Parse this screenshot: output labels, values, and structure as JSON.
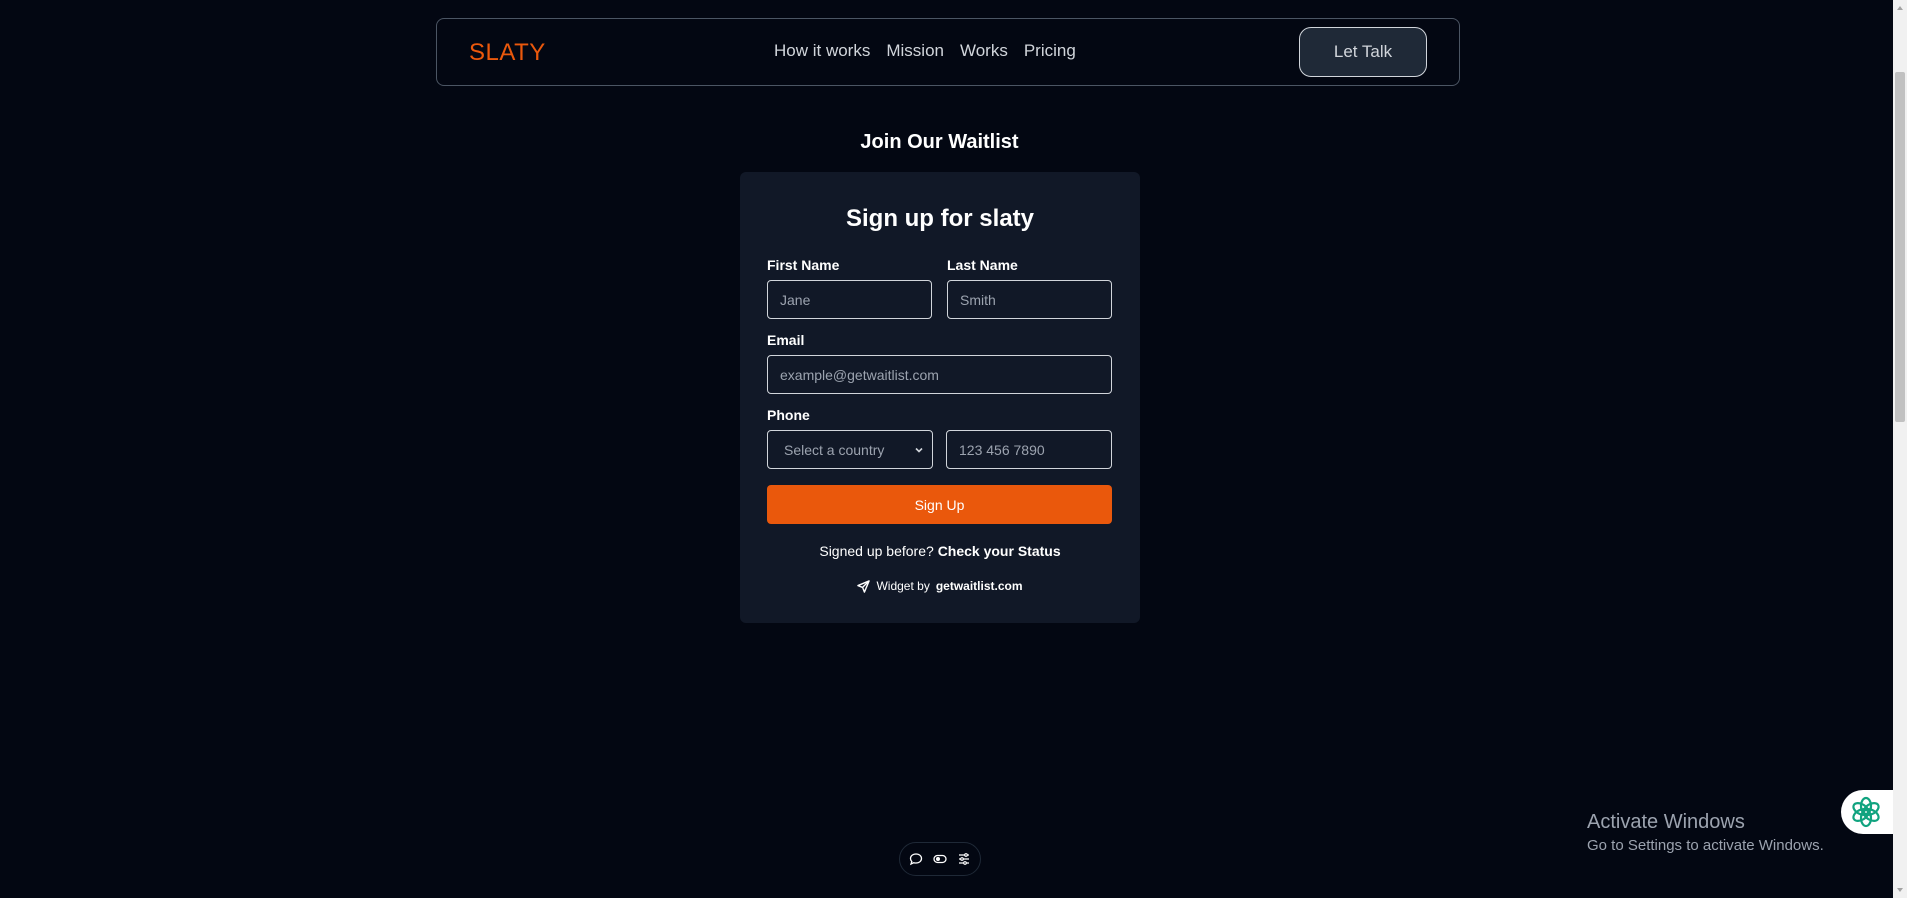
{
  "nav": {
    "brand": "SLATY",
    "links": [
      "How it works",
      "Mission",
      "Works",
      "Pricing"
    ],
    "cta_label": "Let Talk"
  },
  "waitlist": {
    "heading": "Join Our Waitlist"
  },
  "form": {
    "title": "Sign up for slaty",
    "first_name": {
      "label": "First Name",
      "placeholder": "Jane"
    },
    "last_name": {
      "label": "Last Name",
      "placeholder": "Smith"
    },
    "email": {
      "label": "Email",
      "placeholder": "example@getwaitlist.com"
    },
    "phone": {
      "label": "Phone",
      "country_selected": "Select a country",
      "placeholder": "123 456 7890"
    },
    "submit_label": "Sign Up",
    "status_prefix": "Signed up before?",
    "status_link": "Check your Status",
    "widget_prefix": "Widget by",
    "widget_link": "getwaitlist.com"
  },
  "toolbar": {
    "icons": [
      "comment-icon",
      "toggle-icon",
      "settings-list-icon"
    ]
  },
  "windows_notice": {
    "title": "Activate Windows",
    "subtitle": "Go to Settings to activate Windows."
  },
  "colors": {
    "background": "#030712",
    "card": "#111827",
    "accent": "#ea580c",
    "assistant_icon": "#10a37f"
  }
}
